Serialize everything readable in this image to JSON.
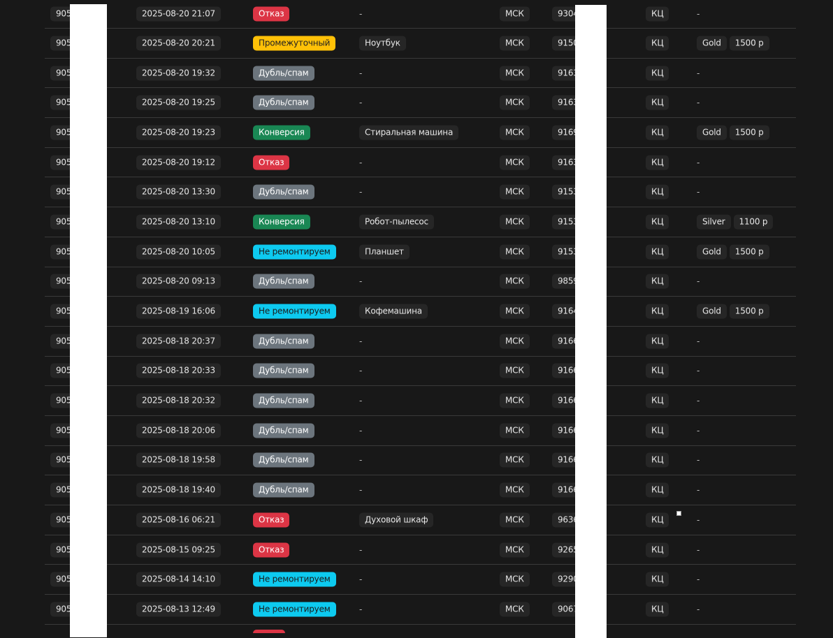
{
  "rows": [
    {
      "id": "905",
      "date": "2025-08-20 21:07",
      "status": "Отказ",
      "status_type": "refuse",
      "device": "-",
      "city": "МСК",
      "phone": "9304",
      "kc": "КЦ",
      "tariff": "-",
      "price": ""
    },
    {
      "id": "905",
      "date": "2025-08-20 20:21",
      "status": "Промежуточный",
      "status_type": "inter",
      "device": "Ноутбук",
      "city": "МСК",
      "phone": "9150",
      "kc": "КЦ",
      "tariff": "Gold",
      "price": "1500 р"
    },
    {
      "id": "905",
      "date": "2025-08-20 19:32",
      "status": "Дубль/спам",
      "status_type": "spam",
      "device": "-",
      "city": "МСК",
      "phone": "9163",
      "kc": "КЦ",
      "tariff": "-",
      "price": ""
    },
    {
      "id": "905",
      "date": "2025-08-20 19:25",
      "status": "Дубль/спам",
      "status_type": "spam",
      "device": "-",
      "city": "МСК",
      "phone": "9163",
      "kc": "КЦ",
      "tariff": "-",
      "price": ""
    },
    {
      "id": "905",
      "date": "2025-08-20 19:23",
      "status": "Конверсия",
      "status_type": "conv",
      "device": "Стиральная машина",
      "city": "МСК",
      "phone": "9169",
      "kc": "КЦ",
      "tariff": "Gold",
      "price": "1500 р"
    },
    {
      "id": "905",
      "date": "2025-08-20 19:12",
      "status": "Отказ",
      "status_type": "refuse",
      "device": "-",
      "city": "МСК",
      "phone": "9163",
      "kc": "КЦ",
      "tariff": "-",
      "price": ""
    },
    {
      "id": "905",
      "date": "2025-08-20 13:30",
      "status": "Дубль/спам",
      "status_type": "spam",
      "device": "-",
      "city": "МСК",
      "phone": "9153",
      "kc": "КЦ",
      "tariff": "-",
      "price": ""
    },
    {
      "id": "905",
      "date": "2025-08-20 13:10",
      "status": "Конверсия",
      "status_type": "conv",
      "device": "Робот-пылесос",
      "city": "МСК",
      "phone": "9153",
      "kc": "КЦ",
      "tariff": "Silver",
      "price": "1100 р"
    },
    {
      "id": "905",
      "date": "2025-08-20 10:05",
      "status": "Не ремонтируем",
      "status_type": "norepair",
      "device": "Планшет",
      "city": "МСК",
      "phone": "9153",
      "kc": "КЦ",
      "tariff": "Gold",
      "price": "1500 р"
    },
    {
      "id": "905",
      "date": "2025-08-20 09:13",
      "status": "Дубль/спам",
      "status_type": "spam",
      "device": "-",
      "city": "МСК",
      "phone": "9859",
      "kc": "КЦ",
      "tariff": "-",
      "price": ""
    },
    {
      "id": "905",
      "date": "2025-08-19 16:06",
      "status": "Не ремонтируем",
      "status_type": "norepair",
      "device": "Кофемашина",
      "city": "МСК",
      "phone": "9164",
      "kc": "КЦ",
      "tariff": "Gold",
      "price": "1500 р"
    },
    {
      "id": "905",
      "date": "2025-08-18 20:37",
      "status": "Дубль/спам",
      "status_type": "spam",
      "device": "-",
      "city": "МСК",
      "phone": "9166",
      "kc": "КЦ",
      "tariff": "-",
      "price": ""
    },
    {
      "id": "905",
      "date": "2025-08-18 20:33",
      "status": "Дубль/спам",
      "status_type": "spam",
      "device": "-",
      "city": "МСК",
      "phone": "9166",
      "kc": "КЦ",
      "tariff": "-",
      "price": ""
    },
    {
      "id": "905",
      "date": "2025-08-18 20:32",
      "status": "Дубль/спам",
      "status_type": "spam",
      "device": "-",
      "city": "МСК",
      "phone": "9166",
      "kc": "КЦ",
      "tariff": "-",
      "price": ""
    },
    {
      "id": "905",
      "date": "2025-08-18 20:06",
      "status": "Дубль/спам",
      "status_type": "spam",
      "device": "-",
      "city": "МСК",
      "phone": "9166",
      "kc": "КЦ",
      "tariff": "-",
      "price": ""
    },
    {
      "id": "905",
      "date": "2025-08-18 19:58",
      "status": "Дубль/спам",
      "status_type": "spam",
      "device": "-",
      "city": "МСК",
      "phone": "9166",
      "kc": "КЦ",
      "tariff": "-",
      "price": ""
    },
    {
      "id": "905",
      "date": "2025-08-18 19:40",
      "status": "Дубль/спам",
      "status_type": "spam",
      "device": "-",
      "city": "МСК",
      "phone": "9166",
      "kc": "КЦ",
      "tariff": "-",
      "price": ""
    },
    {
      "id": "905",
      "date": "2025-08-16 06:21",
      "status": "Отказ",
      "status_type": "refuse",
      "device": "Духовой шкаф",
      "city": "МСК",
      "phone": "9636",
      "kc": "КЦ",
      "tariff": "-",
      "price": ""
    },
    {
      "id": "905",
      "date": "2025-08-15 09:25",
      "status": "Отказ",
      "status_type": "refuse",
      "device": "-",
      "city": "МСК",
      "phone": "9265",
      "kc": "КЦ",
      "tariff": "-",
      "price": ""
    },
    {
      "id": "905",
      "date": "2025-08-14 14:10",
      "status": "Не ремонтируем",
      "status_type": "norepair",
      "device": "-",
      "city": "МСК",
      "phone": "9290",
      "kc": "КЦ",
      "tariff": "-",
      "price": ""
    },
    {
      "id": "905",
      "date": "2025-08-13 12:49",
      "status": "Не ремонтируем",
      "status_type": "norepair",
      "device": "-",
      "city": "МСК",
      "phone": "9067",
      "kc": "КЦ",
      "tariff": "-",
      "price": ""
    }
  ],
  "colors": {
    "background": "#181818",
    "refuse": "#dc3545",
    "inter": "#ffc107",
    "spam": "#6c757d",
    "conv": "#198754",
    "norepair": "#0dcaf0"
  }
}
